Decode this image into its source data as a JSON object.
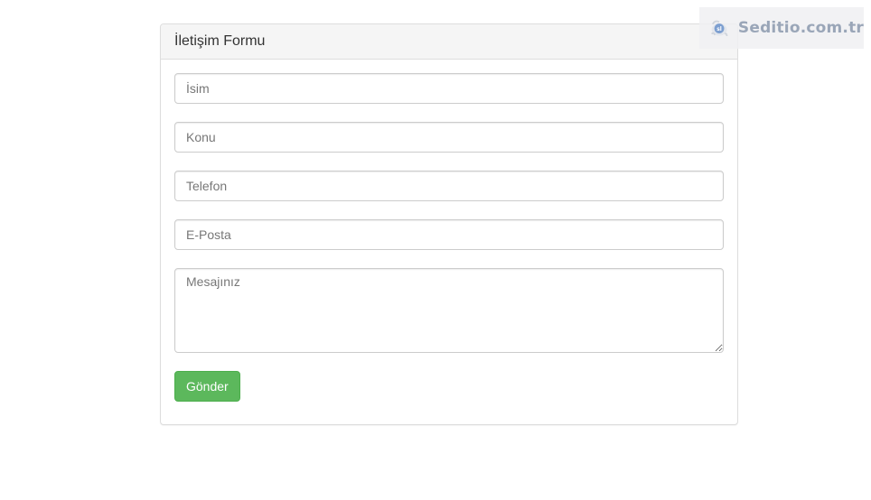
{
  "form": {
    "title": "İletişim Formu",
    "fields": {
      "name_placeholder": "İsim",
      "subject_placeholder": "Konu",
      "phone_placeholder": "Telefon",
      "email_placeholder": "E-Posta",
      "message_placeholder": "Mesajınız"
    },
    "submit_label": "Gönder"
  },
  "watermark": {
    "text": "Seditio.com.tr",
    "icon": "seditio-logo-icon"
  },
  "colors": {
    "submit_button": "#5cb85c",
    "panel_heading_bg": "#f5f5f5",
    "border": "#dddddd",
    "watermark_text": "#9aa6b8"
  }
}
